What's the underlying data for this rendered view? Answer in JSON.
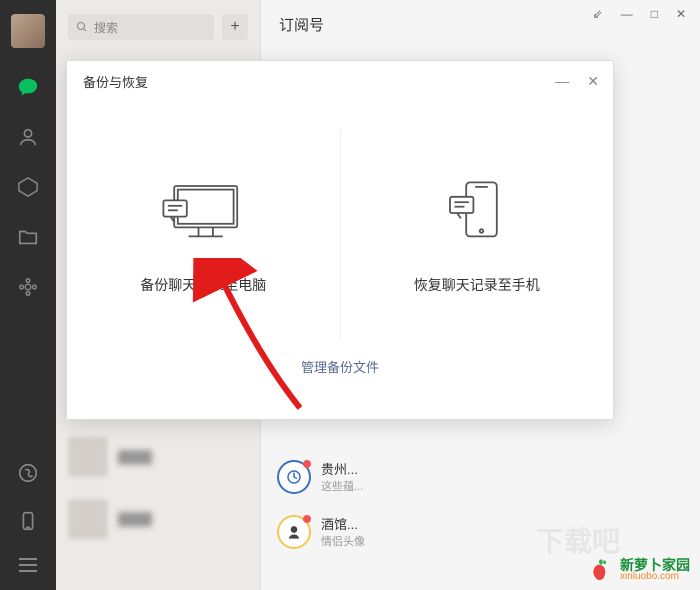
{
  "window": {
    "pin": "☍",
    "min": "—",
    "max": "□",
    "close": "✕"
  },
  "sidebar": {
    "icons": [
      "chat",
      "contacts",
      "favorites",
      "files",
      "settings",
      "mini",
      "phone"
    ]
  },
  "search": {
    "placeholder": "搜索",
    "add": "+"
  },
  "main": {
    "tab_title": "订阅号"
  },
  "subs": [
    {
      "title": "贵州...",
      "desc": "这些蕴..."
    },
    {
      "title": "酒馆...",
      "desc": "情侣头像"
    }
  ],
  "dialog": {
    "title": "备份与恢复",
    "min": "—",
    "close": "✕",
    "option_backup": "备份聊天记录至电脑",
    "option_restore": "恢复聊天记录至手机",
    "manage": "管理备份文件"
  },
  "watermark": {
    "cn": "新萝卜家园",
    "en": "xinluobo.com",
    "ghost": "下载吧"
  }
}
